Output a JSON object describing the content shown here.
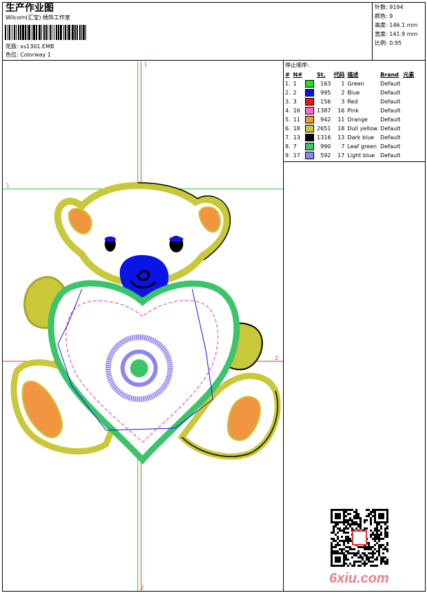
{
  "header": {
    "title": "生产作业图",
    "subtitle": "Wilcom(汇宝) 绣饰工作室",
    "design_label": "花版:",
    "design_value": "xs1301.EMB",
    "colorway_label": "色位:",
    "colorway_value": "Colorway 1"
  },
  "stats": [
    {
      "label": "针数:",
      "value": "9194"
    },
    {
      "label": "颜色:",
      "value": "9"
    },
    {
      "label": "高度:",
      "value": "146.1 mm"
    },
    {
      "label": "宽度:",
      "value": "141.9 mm"
    },
    {
      "label": "比例:",
      "value": "0.95"
    }
  ],
  "stop_sequence": {
    "title": "停止顺序:",
    "headers": [
      "#",
      "N#",
      "St.",
      "代码",
      "描述",
      "Brand",
      "元素"
    ],
    "rows": [
      {
        "idx": "1.",
        "n": "1",
        "color": "#22dd22",
        "st": "163",
        "code": "1",
        "desc": "Green",
        "brand": "Default"
      },
      {
        "idx": "2.",
        "n": "2",
        "color": "#0a14e6",
        "st": "995",
        "code": "2",
        "desc": "Blue",
        "brand": "Default"
      },
      {
        "idx": "3.",
        "n": "3",
        "color": "#e31b1b",
        "st": "156",
        "code": "3",
        "desc": "Red",
        "brand": "Default"
      },
      {
        "idx": "4.",
        "n": "16",
        "color": "#f56cc8",
        "st": "1387",
        "code": "16",
        "desc": "Pink",
        "brand": "Default"
      },
      {
        "idx": "5.",
        "n": "11",
        "color": "#f29540",
        "st": "942",
        "code": "11",
        "desc": "Orange",
        "brand": "Default"
      },
      {
        "idx": "6.",
        "n": "18",
        "color": "#c9c838",
        "st": "2651",
        "code": "18",
        "desc": "Dull yellow",
        "brand": "Default"
      },
      {
        "idx": "7.",
        "n": "13",
        "color": "#000000",
        "st": "1316",
        "code": "13",
        "desc": "Dark blue",
        "brand": "Default"
      },
      {
        "idx": "8.",
        "n": "7",
        "color": "#3cc46a",
        "st": "990",
        "code": "7",
        "desc": "Leaf green",
        "brand": "Default"
      },
      {
        "idx": "9.",
        "n": "17",
        "color": "#8a86f2",
        "st": "592",
        "code": "17",
        "desc": "Light blue",
        "brand": "Default"
      }
    ]
  },
  "canvas": {
    "marker_top": "1",
    "marker_left": "1",
    "marker_right": "2",
    "marker_bottom": "2"
  },
  "watermark": {
    "text": "6xiu.com"
  }
}
